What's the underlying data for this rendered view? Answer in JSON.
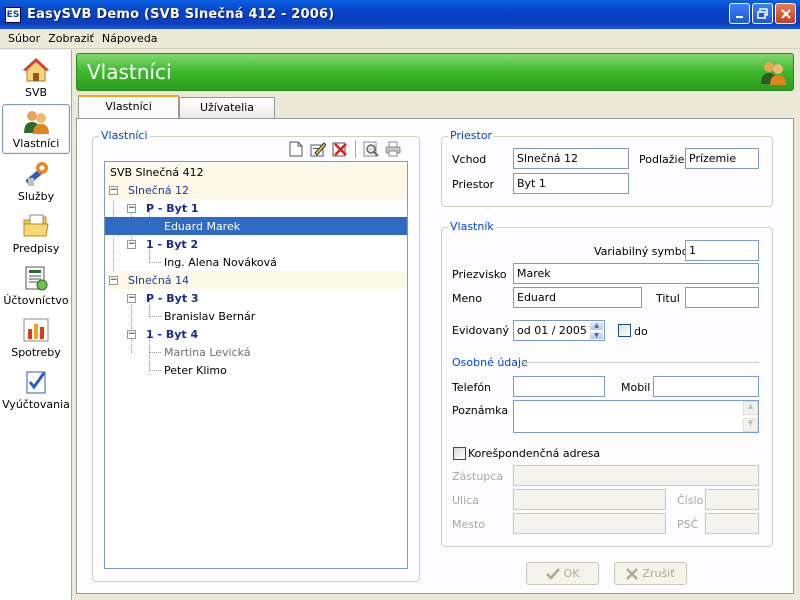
{
  "window": {
    "app_icon": "ES",
    "title": "EasySVB Demo  (SVB Slnečná 412 - 2006)",
    "controls": [
      "minimize-icon",
      "restore-icon",
      "close-icon"
    ]
  },
  "menu": [
    "Súbor",
    "Zobraziť",
    "Nápoveda"
  ],
  "nav": [
    {
      "label": "SVB",
      "icon": "house-icon"
    },
    {
      "label": "Vlastníci",
      "icon": "people-icon"
    },
    {
      "label": "Služby",
      "icon": "tools-icon"
    },
    {
      "label": "Predpisy",
      "icon": "folder-icon"
    },
    {
      "label": "Účtovníctvo",
      "icon": "ledger-icon"
    },
    {
      "label": "Spotreby",
      "icon": "bar-chart-icon"
    },
    {
      "label": "Vyúčtovania",
      "icon": "checklist-icon"
    }
  ],
  "header": {
    "title": "Vlastníci",
    "icon": "people-icon"
  },
  "tabs": [
    "Vlastníci",
    "Užívatelia"
  ],
  "tree_group": {
    "label": "Vlastníci",
    "toolbar": [
      "new-document-icon",
      "edit-icon",
      "delete-icon",
      "preview-icon",
      "print-icon"
    ]
  },
  "tree": {
    "root": "SVB Slnečná 412",
    "entrance1": "Slnečná 12",
    "flat1": "P - Byt 1",
    "owner1": "Eduard Marek",
    "flat2": "1 - Byt 2",
    "owner2": "Ing. Alena Nováková",
    "entrance2": "Slnečná 14",
    "flat3": "P - Byt 3",
    "owner3": "Branislav Bernár",
    "flat4": "1 - Byt 4",
    "owner4": "Martina Levická",
    "owner5": "Peter Klimo"
  },
  "priestor": {
    "label": "Priestor",
    "vchod_label": "Vchod",
    "vchod_value": "Slnečná 12",
    "podlazie_label": "Podlažie",
    "podlazie_value": "Prízemie",
    "priestor_label": "Priestor",
    "priestor_value": "Byt 1"
  },
  "vlastnik": {
    "label": "Vlastník",
    "vs_label": "Variabilný symbol",
    "vs_value": "1",
    "priezvisko_label": "Priezvisko",
    "priezvisko_value": "Marek",
    "meno_label": "Meno",
    "meno_value": "Eduard",
    "titul_label": "Titul",
    "titul_value": "",
    "evidovany_label": "Evidovaný",
    "evidovany_value": "od 01 / 2005",
    "do_label": "do",
    "osobne_label": "Osobné údaje",
    "telefon_label": "Telefón",
    "telefon_value": "",
    "mobil_label": "Mobil",
    "mobil_value": "",
    "poznamka_label": "Poznámka",
    "poznamka_value": "",
    "koresp_label": "Korešpondenčná adresa",
    "zastupca_label": "Zástupca",
    "ulica_label": "Ulica",
    "cislo_label": "Číslo",
    "mesto_label": "Mesto",
    "psc_label": "PSČ"
  },
  "buttons": {
    "ok": "OK",
    "cancel": "Zrušiť"
  },
  "colors": {
    "header_green": "#3db72c",
    "selection_blue": "#316ac5",
    "groupbox_title": "#0046d5",
    "titlebar_blue": "#0a3fbf"
  }
}
